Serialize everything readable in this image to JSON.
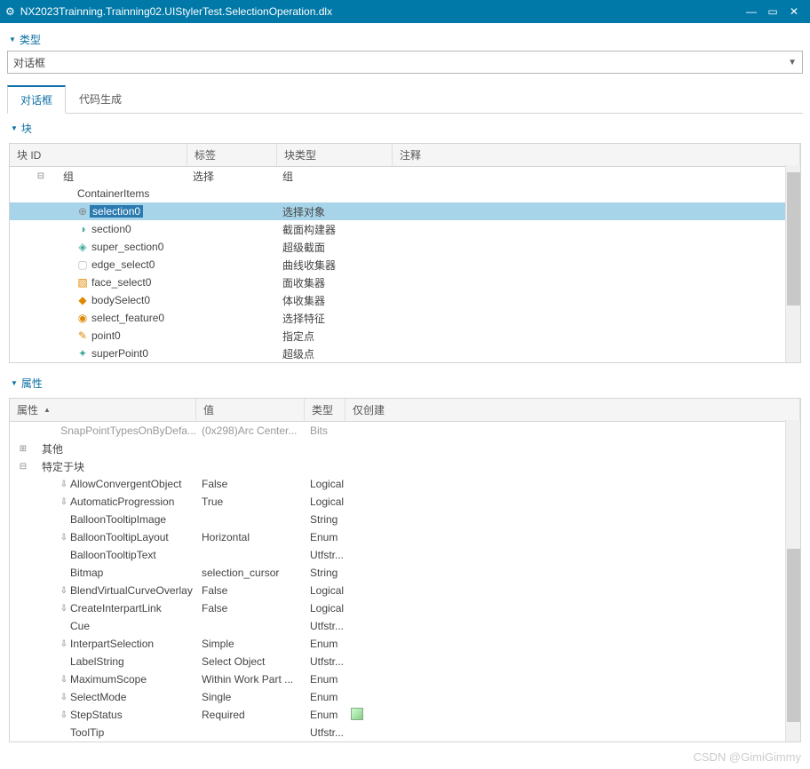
{
  "titlebar": {
    "title": "NX2023Trainning.Trainning02.UIStylerTest.SelectionOperation.dlx"
  },
  "sections": {
    "type_header": "类型",
    "type_value": "对话框",
    "block_header": "块",
    "prop_header": "属性"
  },
  "tabs": {
    "tab1": "对话框",
    "tab2": "代码生成"
  },
  "tree": {
    "headers": {
      "id": "块 ID",
      "label": "标签",
      "type": "块类型",
      "comment": "注释"
    },
    "rows": [
      {
        "indent": 1,
        "toggle": "-",
        "icon": "",
        "name": "组",
        "label": "选择",
        "type": "组",
        "selected": false
      },
      {
        "indent": 2,
        "toggle": "",
        "icon": "",
        "name": "ContainerItems",
        "label": "",
        "type": "",
        "selected": false
      },
      {
        "indent": 3,
        "toggle": "",
        "icon": "⊕",
        "name": "selection0",
        "label": "",
        "type": "选择对象",
        "selected": true
      },
      {
        "indent": 3,
        "toggle": "",
        "icon": "◑",
        "name": "section0",
        "label": "",
        "type": "截面构建器",
        "selected": false
      },
      {
        "indent": 3,
        "toggle": "",
        "icon": "◈",
        "name": "super_section0",
        "label": "",
        "type": "超级截面",
        "selected": false
      },
      {
        "indent": 3,
        "toggle": "",
        "icon": "▢",
        "name": "edge_select0",
        "label": "",
        "type": "曲线收集器",
        "selected": false
      },
      {
        "indent": 3,
        "toggle": "",
        "icon": "▧",
        "name": "face_select0",
        "label": "",
        "type": "面收集器",
        "selected": false
      },
      {
        "indent": 3,
        "toggle": "",
        "icon": "◆",
        "name": "bodySelect0",
        "label": "",
        "type": "体收集器",
        "selected": false
      },
      {
        "indent": 3,
        "toggle": "",
        "icon": "◉",
        "name": "select_feature0",
        "label": "",
        "type": "选择特征",
        "selected": false
      },
      {
        "indent": 3,
        "toggle": "",
        "icon": "✎",
        "name": "point0",
        "label": "",
        "type": "指定点",
        "selected": false
      },
      {
        "indent": 3,
        "toggle": "",
        "icon": "✦",
        "name": "superPoint0",
        "label": "",
        "type": "超级点",
        "selected": false
      }
    ]
  },
  "props": {
    "headers": {
      "name": "属性",
      "value": "值",
      "type": "类型",
      "create": "仅创建"
    },
    "rows": [
      {
        "indent": 2,
        "toggle": "",
        "icon": "",
        "name": "SnapPointTypesOnByDefa...",
        "value": "(0x298)Arc Center...",
        "type": "Bits",
        "disabled": true
      },
      {
        "indent": 0,
        "toggle": "+",
        "icon": "",
        "name": "其他",
        "value": "",
        "type": ""
      },
      {
        "indent": 0,
        "toggle": "-",
        "icon": "",
        "name": "特定于块",
        "value": "",
        "type": ""
      },
      {
        "indent": 2,
        "toggle": "",
        "icon": "↓",
        "name": "AllowConvergentObject",
        "value": "False",
        "type": "Logical"
      },
      {
        "indent": 2,
        "toggle": "",
        "icon": "↓",
        "name": "AutomaticProgression",
        "value": "True",
        "type": "Logical"
      },
      {
        "indent": 2,
        "toggle": "",
        "icon": "",
        "name": "BalloonTooltipImage",
        "value": "",
        "type": "String"
      },
      {
        "indent": 2,
        "toggle": "",
        "icon": "↓",
        "name": "BalloonTooltipLayout",
        "value": "Horizontal",
        "type": "Enum"
      },
      {
        "indent": 2,
        "toggle": "",
        "icon": "",
        "name": "BalloonTooltipText",
        "value": "",
        "type": "Utfstr..."
      },
      {
        "indent": 2,
        "toggle": "",
        "icon": "",
        "name": "Bitmap",
        "value": "selection_cursor",
        "type": "String"
      },
      {
        "indent": 2,
        "toggle": "",
        "icon": "↓",
        "name": "BlendVirtualCurveOverlay",
        "value": "False",
        "type": "Logical"
      },
      {
        "indent": 2,
        "toggle": "",
        "icon": "↓",
        "name": "CreateInterpartLink",
        "value": "False",
        "type": "Logical"
      },
      {
        "indent": 2,
        "toggle": "",
        "icon": "",
        "name": "Cue",
        "value": "",
        "type": "Utfstr..."
      },
      {
        "indent": 2,
        "toggle": "",
        "icon": "↓",
        "name": "InterpartSelection",
        "value": "Simple",
        "type": "Enum"
      },
      {
        "indent": 2,
        "toggle": "",
        "icon": "",
        "name": "LabelString",
        "value": "Select Object",
        "type": "Utfstr..."
      },
      {
        "indent": 2,
        "toggle": "",
        "icon": "↓",
        "name": "MaximumScope",
        "value": "Within Work Part ...",
        "type": "Enum"
      },
      {
        "indent": 2,
        "toggle": "",
        "icon": "↓",
        "name": "SelectMode",
        "value": "Single",
        "type": "Enum"
      },
      {
        "indent": 2,
        "toggle": "",
        "icon": "↓",
        "name": "StepStatus",
        "value": "Required",
        "type": "Enum",
        "create_icon": true
      },
      {
        "indent": 2,
        "toggle": "",
        "icon": "",
        "name": "ToolTip",
        "value": "",
        "type": "Utfstr..."
      }
    ]
  },
  "watermark": "CSDN @GimiGimmy"
}
